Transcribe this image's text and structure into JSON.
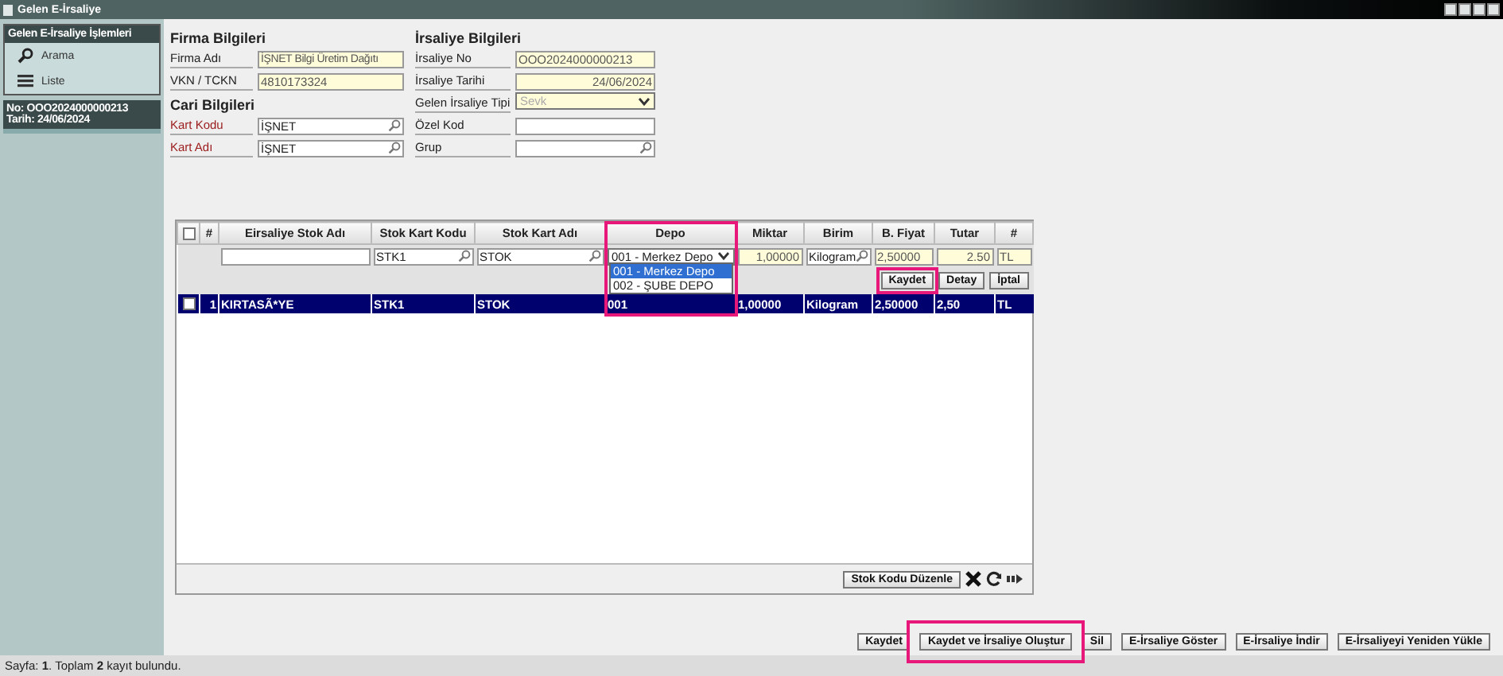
{
  "window": {
    "title": "Gelen E-İrsaliye"
  },
  "sidebar": {
    "title": "Gelen E-İrsaliye İşlemleri",
    "items": [
      {
        "kind": "search",
        "label": "Arama"
      },
      {
        "kind": "list",
        "label": "Liste"
      }
    ],
    "summary": [
      "No: OOO2024000000213",
      "Tarih: 24/06/2024"
    ]
  },
  "form": {
    "columns": [
      {
        "rows": [
          {
            "kind": "heading",
            "label": "Firma Bilgileri"
          },
          {
            "kind": "field",
            "label": "Firma Adı",
            "required": false,
            "readonly": true,
            "lookup": false,
            "value": "İŞNET Bilgi Üretim Dağıtı"
          },
          {
            "kind": "field",
            "label": "VKN / TCKN",
            "required": false,
            "readonly": true,
            "lookup": false,
            "value": "4810173324"
          },
          {
            "kind": "heading",
            "label": "Cari Bilgileri"
          },
          {
            "kind": "field",
            "label": "Kart Kodu",
            "required": true,
            "readonly": false,
            "lookup": true,
            "value": "İŞNET"
          },
          {
            "kind": "field",
            "label": "Kart Adı",
            "required": true,
            "readonly": false,
            "lookup": true,
            "value": "İŞNET"
          }
        ]
      },
      {
        "rows": [
          {
            "kind": "heading",
            "label": "İrsaliye Bilgileri"
          },
          {
            "kind": "field",
            "label": "İrsaliye No",
            "required": false,
            "readonly": true,
            "lookup": false,
            "value": "OOO2024000000213"
          },
          {
            "kind": "date",
            "label": "İrsaliye Tarihi",
            "required": false,
            "readonly": true,
            "lookup": false,
            "value": "24/06/2024"
          },
          {
            "kind": "select",
            "label": "Gelen İrsaliye Tipi",
            "required": false,
            "readonly": true,
            "value": "Sevk"
          },
          {
            "kind": "field",
            "label": "Özel Kod",
            "required": false,
            "readonly": false,
            "lookup": false
          },
          {
            "kind": "field",
            "label": "Grup",
            "required": false,
            "readonly": false,
            "lookup": true
          }
        ]
      }
    ]
  },
  "table": {
    "columns": [
      {
        "kind": "check",
        "checked": false
      },
      {
        "label": "#",
        "highlighted": false
      },
      {
        "label": "Eirsaliye Stok Adı",
        "highlighted": false
      },
      {
        "label": "Stok Kart Kodu",
        "highlighted": false
      },
      {
        "label": "Stok Kart Adı",
        "highlighted": false
      },
      {
        "label": "Depo",
        "highlighted": true
      },
      {
        "label": "Miktar",
        "highlighted": false
      },
      {
        "label": "Birim",
        "highlighted": false
      },
      {
        "label": "B. Fiyat",
        "highlighted": false
      },
      {
        "label": "Tutar",
        "highlighted": false
      },
      {
        "label": "#",
        "highlighted": false
      }
    ],
    "editor": [
      {
        "kind": "none"
      },
      {
        "kind": "none"
      },
      {
        "kind": "text",
        "readonly": false,
        "lookup": false
      },
      {
        "kind": "text",
        "readonly": false,
        "lookup": true,
        "value": "STK1"
      },
      {
        "kind": "text",
        "readonly": false,
        "lookup": true,
        "value": "STOK"
      },
      {
        "kind": "select",
        "value": "001 - Merkez Depo",
        "expanded": true,
        "options": [
          {
            "label": "001 - Merkez Depo",
            "selected": true
          },
          {
            "label": "002 - ŞUBE DEPO",
            "selected": false
          }
        ]
      },
      {
        "kind": "number",
        "readonly": true,
        "lookup": false,
        "value": "1,00000"
      },
      {
        "kind": "text",
        "readonly": false,
        "lookup": true,
        "value": "Kilogram"
      },
      {
        "kind": "text",
        "readonly": true,
        "lookup": false,
        "value": "2,50000"
      },
      {
        "kind": "number",
        "readonly": true,
        "lookup": false,
        "value": "2.50"
      },
      {
        "kind": "text",
        "readonly": true,
        "lookup": false,
        "value": "TL"
      }
    ],
    "editor_buttons": [
      {
        "label": "Kaydet",
        "highlighted": true
      },
      {
        "label": "Detay",
        "highlighted": false
      },
      {
        "label": "İptal",
        "highlighted": false
      }
    ],
    "rows": [
      {
        "checked": false,
        "selected": true,
        "cells": [
          "",
          "1",
          "KIRTASÃ*YE",
          "STK1",
          "STOK",
          "001",
          "1,00000",
          "Kilogram",
          "2,50000",
          "2,50",
          "TL"
        ]
      }
    ],
    "footer_button": "Stok Kodu Düzenle"
  },
  "buttons": [
    {
      "label": "Kaydet",
      "highlighted": false
    },
    {
      "label": "Kaydet ve İrsaliye Oluştur",
      "highlighted": true
    },
    {
      "label": "Sil",
      "highlighted": false
    },
    {
      "label": "E-İrsaliye Göster",
      "highlighted": false
    },
    {
      "label": "E-İrsaliye İndir",
      "highlighted": false
    },
    {
      "label": "E-İrsaliyeyi Yeniden Yükle",
      "highlighted": false
    }
  ],
  "status_bar": "Sayfa: **1**. Toplam **2** kayıt bulundu."
}
